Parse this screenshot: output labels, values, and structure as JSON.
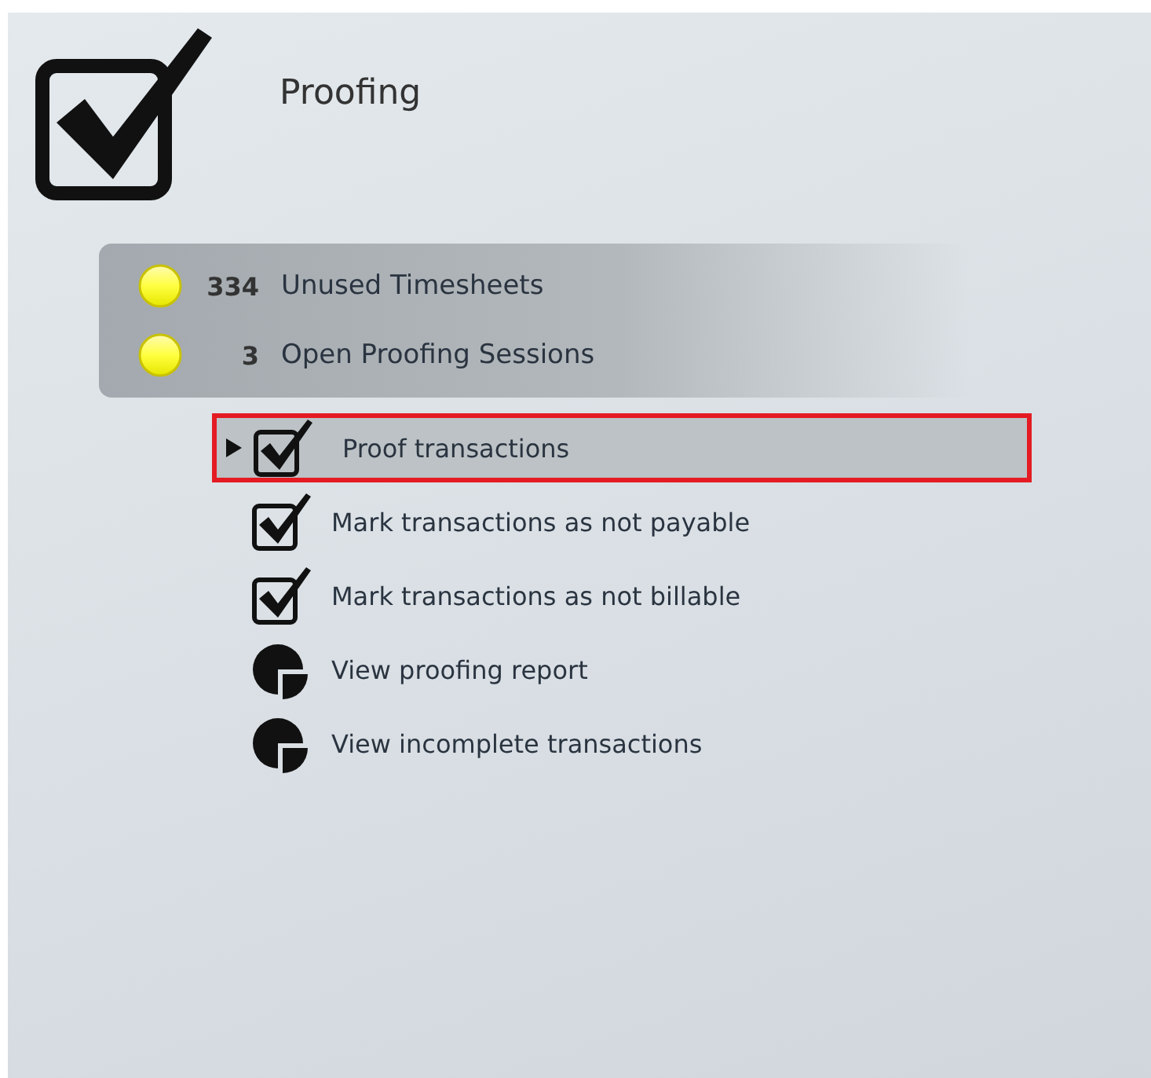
{
  "title": "Proofing",
  "status": [
    {
      "count": "334",
      "label": "Unused Timesheets"
    },
    {
      "count": "3",
      "label": "Open Proofing Sessions"
    }
  ],
  "tasks": [
    {
      "kind": "check",
      "label": "Proof transactions",
      "selected": true
    },
    {
      "kind": "check",
      "label": "Mark transactions as not payable",
      "selected": false
    },
    {
      "kind": "check",
      "label": "Mark transactions as not billable",
      "selected": false
    },
    {
      "kind": "report",
      "label": "View proofing report",
      "selected": false
    },
    {
      "kind": "report",
      "label": "View incomplete transactions",
      "selected": false
    }
  ]
}
